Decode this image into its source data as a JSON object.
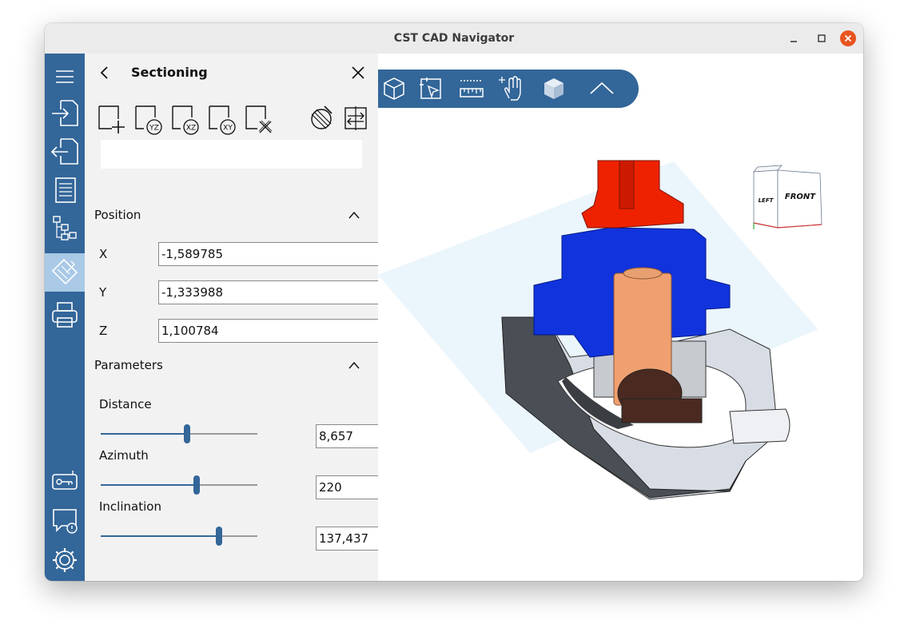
{
  "window": {
    "title": "CST CAD Navigator"
  },
  "panel": {
    "title": "Sectioning",
    "position_header": "Position",
    "parameters_header": "Parameters",
    "section_name_value": "",
    "position": [
      {
        "axis": "X",
        "value": "-1,589785"
      },
      {
        "axis": "Y",
        "value": "-1,333988"
      },
      {
        "axis": "Z",
        "value": "1,100784"
      }
    ],
    "parameters": [
      {
        "label": "Distance",
        "value": "8,657",
        "slider_fraction": 0.55
      },
      {
        "label": "Azimuth",
        "value": "220",
        "slider_fraction": 0.61
      },
      {
        "label": "Inclination",
        "value": "137,437",
        "slider_fraction": 0.755
      }
    ]
  },
  "viewcube": {
    "front_label": "FRONT",
    "left_label": "LEFT"
  },
  "icons": {
    "rail": [
      "menu-icon",
      "import-icon",
      "export-icon",
      "document-icon",
      "tree-icon",
      "sectioning-icon",
      "print-icon",
      "license-icon",
      "feedback-icon",
      "settings-icon"
    ],
    "tools": [
      "add-section-icon",
      "yz-plane-icon",
      "xz-plane-icon",
      "xy-plane-icon",
      "delete-section-icon",
      "clip-toggle-icon",
      "flip-section-icon"
    ],
    "toolbar": [
      "view-cube-icon",
      "select-icon",
      "measure-icon",
      "pan-icon",
      "shaded-view-icon",
      "collapse-toolbar-icon"
    ]
  },
  "colors": {
    "accent": "#336699",
    "rail_active": "#a9c9e6",
    "close_button": "#e95420",
    "model_red": "#ee2200",
    "model_blue": "#1133dd",
    "model_copper": "#f0a070"
  }
}
